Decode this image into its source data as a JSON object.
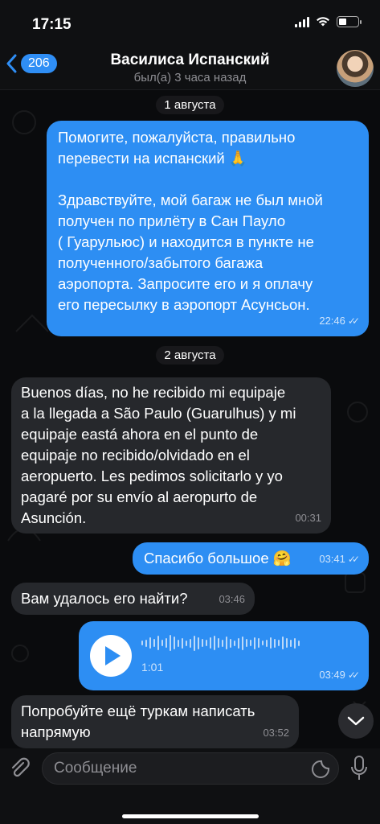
{
  "status_bar": {
    "time": "17:15",
    "battery_level": 0.4
  },
  "header": {
    "back_count": "206",
    "contact_name": "Василиса Испанский",
    "contact_status": "был(а) 3 часа назад"
  },
  "messages": [
    {
      "type": "date",
      "text": "1 августа"
    },
    {
      "type": "outgoing",
      "text": "Помогите, пожалуйста, правильно\nперевести на испанский 🙏\n\nЗдравствуйте, мой багаж не был мной\nполучен по прилёту в Сан Пауло\n( Гуарульюс) и находится в пункте не\nполученного/забытого багажа\nаэропорта. Запросите его и я оплачу\nего пересылку в аэропорт Асунсьон.",
      "time": "22:46",
      "read": true
    },
    {
      "type": "date",
      "text": "2 августа"
    },
    {
      "type": "incoming",
      "text": "Buenos días, no he recibido mi equipaje\na la llegada a São Paulo (Guarulhus) y mi\nequipaje eastá ahora en el punto de\nequipaje no recibido/olvidado en el\naeropuerto. Les pedimos solicitarlo y yo\npagaré por su envío al aeropurto de\nAsunción.",
      "time": "00:31"
    },
    {
      "type": "outgoing",
      "text": "Спасибо большое 🤗",
      "time": "03:41",
      "read": true
    },
    {
      "type": "incoming",
      "text": "Вам удалось его найти?",
      "time": "03:46"
    },
    {
      "type": "outgoing_voice",
      "duration": "1:01",
      "time": "03:49",
      "read": true
    },
    {
      "type": "incoming",
      "text": "Попробуйте ещё туркам написать\nнапрямую",
      "time": "03:52"
    }
  ],
  "composer": {
    "placeholder": "Сообщение"
  },
  "colors": {
    "outgoing_bubble": "#2d8ef3",
    "incoming_bubble": "#26282c",
    "accent": "#2f8ef5"
  },
  "icons": [
    "back-chevron-icon",
    "attach-paperclip-icon",
    "sticker-icon",
    "microphone-icon",
    "chevron-down-icon",
    "play-icon",
    "double-check-icon"
  ]
}
